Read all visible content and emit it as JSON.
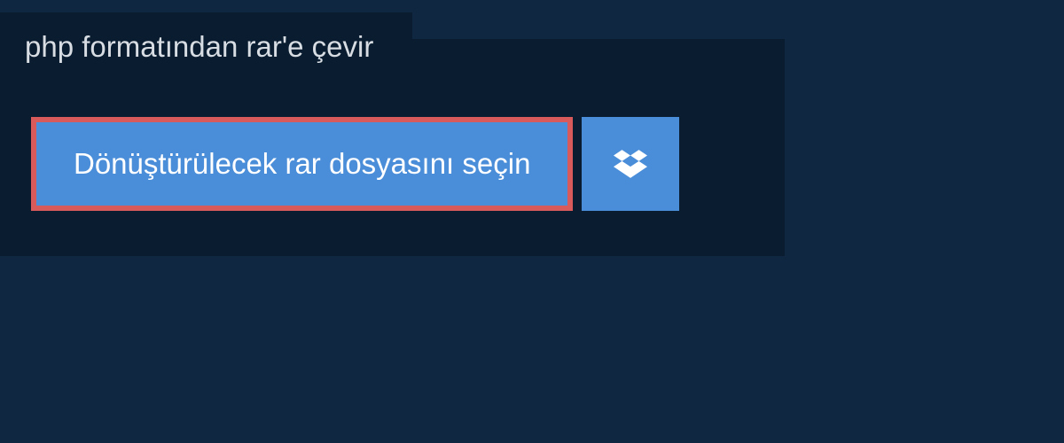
{
  "header": {
    "title": "php formatından rar'e çevir"
  },
  "actions": {
    "select_file_label": "Dönüştürülecek rar dosyasını seçin"
  },
  "colors": {
    "bg_outer": "#0f2740",
    "bg_inner": "#0a1d30",
    "button_bg": "#4a8dd8",
    "button_border": "#d85a5a",
    "text_light": "#d8dde3",
    "text_white": "#ffffff"
  }
}
